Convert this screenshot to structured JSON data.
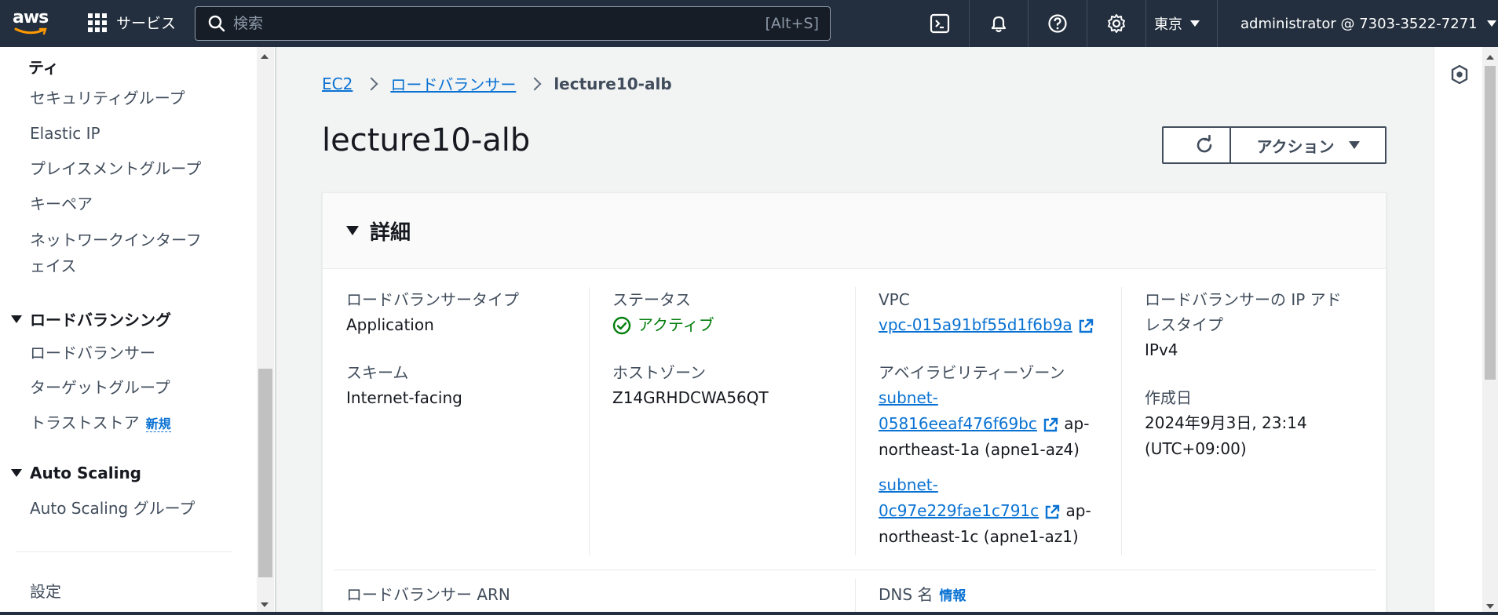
{
  "topnav": {
    "logo_text": "aws",
    "services_label": "サービス",
    "search_placeholder": "検索",
    "search_shortcut": "[Alt+S]",
    "region": "東京",
    "account": "administrator @ 7303-3522-7271",
    "icons": [
      "cloudshell-icon",
      "bell-icon",
      "help-icon",
      "gear-icon"
    ]
  },
  "sidebar": {
    "items": [
      {
        "label": "ティ",
        "kind": "section"
      },
      {
        "label": "セキュリティグループ"
      },
      {
        "label": "Elastic IP"
      },
      {
        "label": "プレイスメントグループ"
      },
      {
        "label": "キーペア"
      },
      {
        "label": "ネットワークインターフェイス"
      },
      {
        "label": "ロードバランシング",
        "kind": "section"
      },
      {
        "label": "ロードバランサー"
      },
      {
        "label": "ターゲットグループ"
      },
      {
        "label": "トラストストア",
        "badge": "新規"
      },
      {
        "label": "Auto Scaling",
        "kind": "section"
      },
      {
        "label": "Auto Scaling グループ"
      },
      {
        "label": "設定"
      }
    ],
    "nic_line1": "ネットワークインターフ",
    "nic_line2": "ェイス"
  },
  "breadcrumb": {
    "items": [
      "EC2",
      "ロードバランサー",
      "lecture10-alb"
    ]
  },
  "page": {
    "title": "lecture10-alb",
    "actions_label": "アクション"
  },
  "details": {
    "heading": "詳細",
    "lb_type_label": "ロードバランサータイプ",
    "lb_type_value": "Application",
    "scheme_label": "スキーム",
    "scheme_value": "Internet-facing",
    "status_label": "ステータス",
    "status_value": "アクティブ",
    "hosted_zone_label": "ホストゾーン",
    "hosted_zone_value": "Z14GRHDCWA56QT",
    "vpc_label": "VPC",
    "vpc_value": "vpc-015a91bf55d1f6b9a",
    "az_label": "アベイラビリティーゾーン",
    "subnets": [
      {
        "id_part1": "subnet-",
        "id_part2": "05816eeaf476f69bc",
        "az_part1": "ap-",
        "az_part2": "northeast-1a (apne1-az4)"
      },
      {
        "id_part1": "subnet-",
        "id_part2": "0c97e229fae1c791c",
        "az_part1": "ap-",
        "az_part2": "northeast-1c (apne1-az1)"
      }
    ],
    "ip_type_label_line1": "ロードバランサーの IP アド",
    "ip_type_label_line2": "レスタイプ",
    "ip_type_value": "IPv4",
    "created_label": "作成日",
    "created_value_line1": "2024年9月3日, 23:14",
    "created_value_line2": "(UTC+09:00)",
    "arn_label": "ロードバランサー ARN",
    "dns_label": "DNS 名",
    "dns_info": "情報"
  },
  "colors": {
    "nav_bg": "#232f3e",
    "link": "#0972d3",
    "success": "#037f0c",
    "page_bg": "#f2f3f3"
  }
}
